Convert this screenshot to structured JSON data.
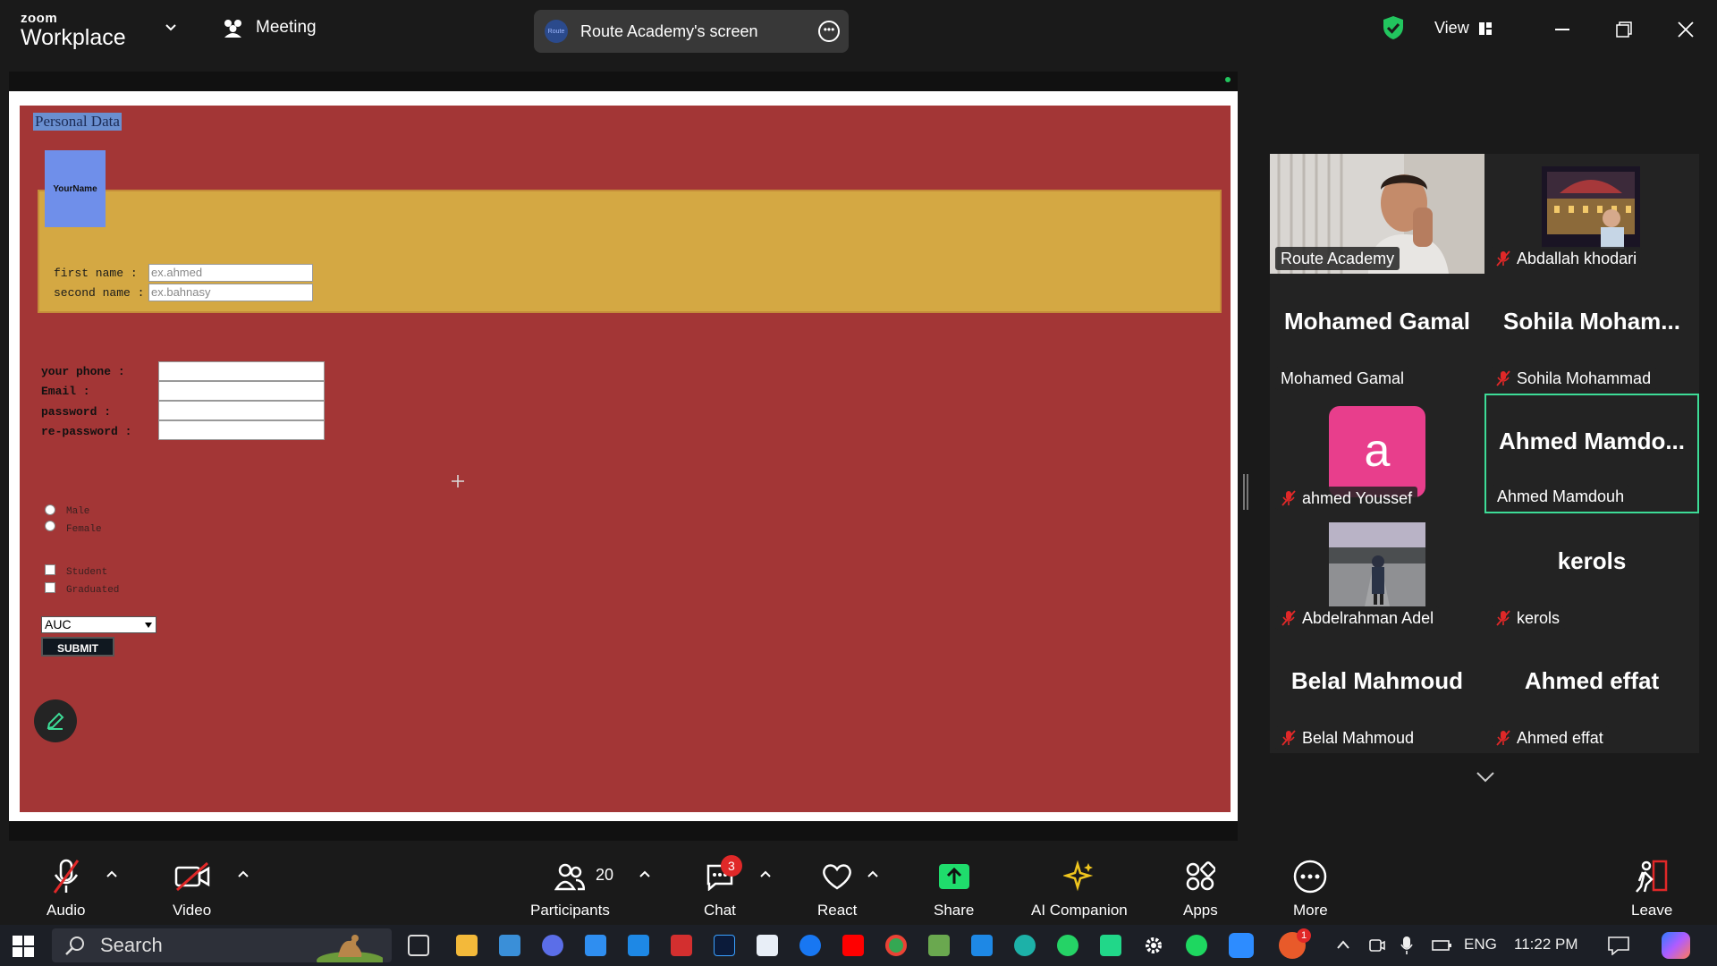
{
  "app": {
    "logo_small": "zoom",
    "logo_big": "Workplace",
    "meeting_label": "Meeting",
    "share_title": "Route Academy's screen",
    "route_logo_text": "Route",
    "view_label": "View"
  },
  "shared_form": {
    "legend": "Personal Data",
    "avatar_text": "YourName",
    "first_name_label": "first name  :",
    "first_name_placeholder": "ex.ahmed",
    "second_name_label": "second name :",
    "second_name_placeholder": "ex.bahnasy",
    "phone_label": "your phone  :",
    "email_label": "Email       :",
    "password_label": "password    :",
    "repassword_label": "re-password :",
    "radio_options": [
      "Male",
      "Female"
    ],
    "checkbox_options": [
      "Student",
      "Graduated"
    ],
    "select_value": "AUC",
    "submit_label": "SUBMIT"
  },
  "participants": [
    {
      "display": "video",
      "label": "Route Academy",
      "muted": false
    },
    {
      "display": "video",
      "label": "Abdallah khodari",
      "muted": true
    },
    {
      "display": "name",
      "big": "Mohamed Gamal",
      "label": "Mohamed Gamal",
      "muted": false
    },
    {
      "display": "name",
      "big": "Sohila  Moham...",
      "label": "Sohila Mohammad",
      "muted": true
    },
    {
      "display": "avatar",
      "initial": "a",
      "label": "ahmed Youssef",
      "muted": true
    },
    {
      "display": "name",
      "big": "Ahmed  Mamdo...",
      "label": "Ahmed Mamdouh",
      "muted": false,
      "active_speaker": true
    },
    {
      "display": "video",
      "label": "Abdelrahman Adel",
      "muted": true
    },
    {
      "display": "name",
      "big": "kerols",
      "label": "kerols",
      "muted": true
    },
    {
      "display": "name",
      "big": "Belal Mahmoud",
      "label": "Belal Mahmoud",
      "muted": true
    },
    {
      "display": "name",
      "big": "Ahmed effat",
      "label": "Ahmed effat",
      "muted": true
    }
  ],
  "toolbar": {
    "audio": "Audio",
    "video": "Video",
    "participants": "Participants",
    "participants_count": "20",
    "chat": "Chat",
    "chat_badge": "3",
    "react": "React",
    "share": "Share",
    "ai": "AI Companion",
    "apps": "Apps",
    "more": "More",
    "leave": "Leave"
  },
  "taskbar": {
    "search_placeholder": "Search",
    "language": "ENG",
    "time": "11:22 PM",
    "notif_badge": "1"
  },
  "colors": {
    "form_bg": "#a33636",
    "name_band": "#d4a843",
    "active_speaker": "#3ddc97",
    "share_green": "#1fdc6c",
    "avatar_pink": "#e83e8c"
  }
}
